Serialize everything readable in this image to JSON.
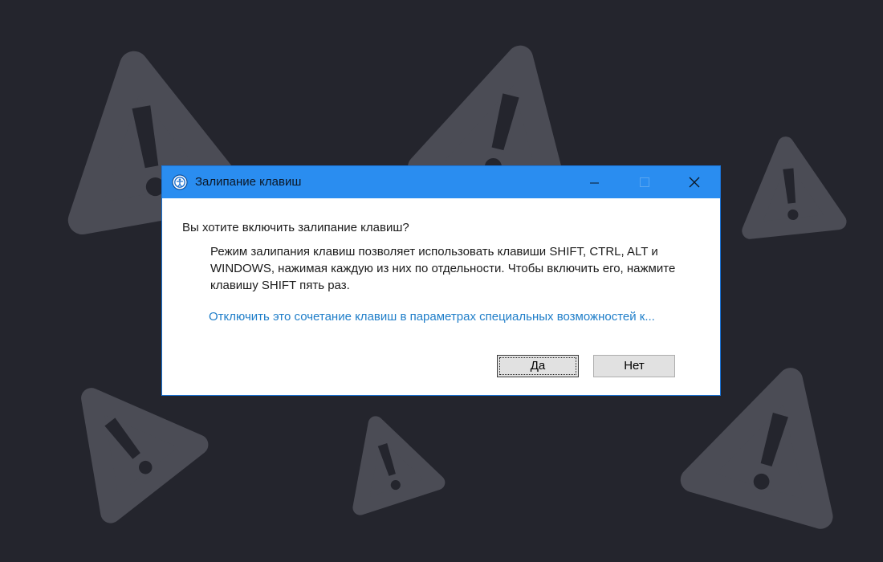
{
  "window": {
    "title": "Залипание клавиш",
    "icon": "accessibility-icon",
    "controls": [
      "minimize-icon",
      "maximize-icon",
      "close-icon"
    ]
  },
  "dialog": {
    "question": "Вы хотите включить залипание клавиш?",
    "description": "Режим залипания клавиш позволяет использовать клавиши SHIFT, CTRL, ALT и WINDOWS, нажимая каждую из них по отдельности. Чтобы включить его, нажмите клавишу SHIFT пять раз.",
    "link": "Отключить это сочетание клавиш в параметрах специальных возможностей к...",
    "buttons": {
      "yes": "Да",
      "no": "Нет"
    }
  },
  "background": {
    "color": "#24252d",
    "decoration": "warning-triangle-icon",
    "decoration_color": "#4b4c55"
  },
  "colors": {
    "titlebar": "#2a8df0",
    "link": "#1f7ec9",
    "button_face": "#e1e1e1"
  }
}
